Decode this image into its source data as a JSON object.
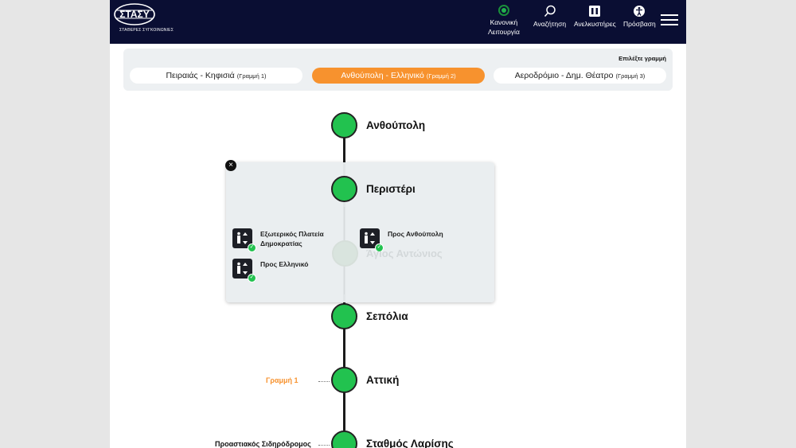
{
  "header": {
    "logo_text": "ΣΤΑΣΥ",
    "logo_subtitle": "ΣΤΑΘΕΡΕΣ ΣΥΓΚΟΙΝΩΝΙΕΣ",
    "status_label_1": "Κανονική",
    "status_label_2": "Λειτουργία",
    "search_label": "Αναζήτηση",
    "elevators_label": "Ανελκυστήρες",
    "access_label": "Πρόσβαση"
  },
  "selector": {
    "title": "Επιλέξτε γραμμή",
    "lines": [
      {
        "name": "Πειραιάς - Κηφισιά",
        "tag": "(Γραμμή 1)",
        "active": false
      },
      {
        "name": "Ανθούπολη - Ελληνικό",
        "tag": "(Γραμμή 2)",
        "active": true
      },
      {
        "name": "Αεροδρόμιο - Δημ. Θέατρο",
        "tag": "(Γραμμή 3)",
        "active": false
      }
    ]
  },
  "stations": {
    "s1": "Ανθούπολη",
    "s2": "Περιστέρι",
    "s3": "Άγιος Αντώνιος",
    "s4": "Σεπόλια",
    "s5": "Αττική",
    "s6": "Σταθμός Λαρίσης"
  },
  "connections": {
    "attiki": "Γραμμή 1",
    "larisis": "Προαστιακός Σιδηρόδρομος"
  },
  "popup": {
    "elevators": [
      {
        "label_1": "Εξωτερικός Πλατεία",
        "label_2": "Δημοκρατίας",
        "status": "working"
      },
      {
        "label_1": "Προς Ελληνικό",
        "label_2": "",
        "status": "working"
      },
      {
        "label_1": "Προς Ανθούπολη",
        "label_2": "",
        "status": "working"
      }
    ],
    "close_symbol": "×"
  },
  "colors": {
    "header_bg": "#0a0e33",
    "active_line": "#f7922e",
    "station_green": "#22c24f",
    "line1_color": "#f7922e"
  }
}
